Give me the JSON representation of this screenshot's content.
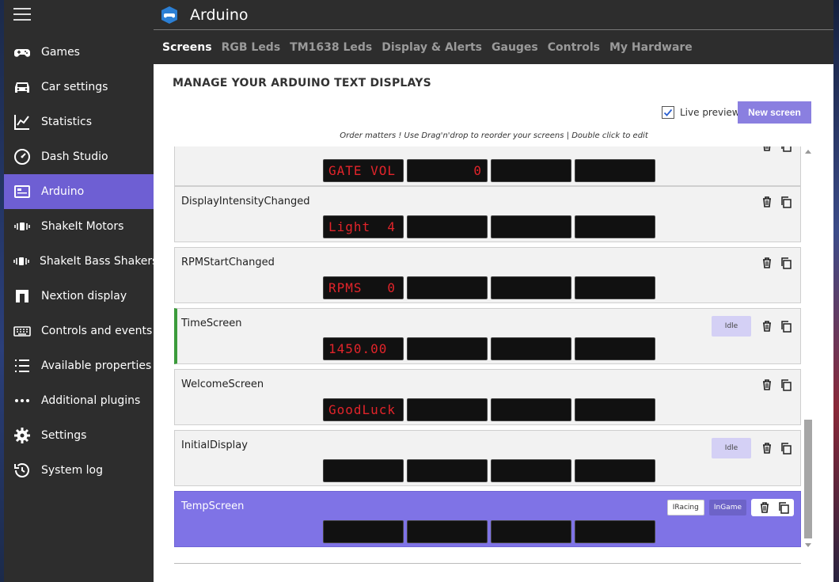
{
  "app": {
    "title": "Arduino"
  },
  "colors": {
    "accent": "#6e5fd3",
    "sidebar": "#2d2d2d",
    "segment_text": "#e2242a"
  },
  "sidebar": {
    "items": [
      {
        "label": "Games",
        "icon": "gamepad-icon"
      },
      {
        "label": "Car settings",
        "icon": "car-icon"
      },
      {
        "label": "Statistics",
        "icon": "chart-icon"
      },
      {
        "label": "Dash Studio",
        "icon": "gauge-icon"
      },
      {
        "label": "Arduino",
        "icon": "arduino-board-icon",
        "active": true
      },
      {
        "label": "ShakeIt Motors",
        "icon": "vibration-icon"
      },
      {
        "label": "ShakeIt Bass Shakers",
        "icon": "vibration-icon"
      },
      {
        "label": "Nextion display",
        "icon": "nextion-icon"
      },
      {
        "label": "Controls and events",
        "icon": "keyboard-icon"
      },
      {
        "label": "Available properties",
        "icon": "list-icon"
      },
      {
        "label": "Additional plugins",
        "icon": "more-dots-icon"
      },
      {
        "label": "Settings",
        "icon": "gear-icon"
      },
      {
        "label": "System log",
        "icon": "history-icon"
      }
    ]
  },
  "tabs": [
    "Screens",
    "RGB Leds",
    "TM1638 Leds",
    "Display & Alerts",
    "Gauges",
    "Controls",
    "My Hardware"
  ],
  "main": {
    "title": "MANAGE YOUR ARDUINO TEXT DISPLAYS",
    "live_preview_label": "Live preview",
    "live_preview_checked": true,
    "new_screen_label": "New screen",
    "hint": "Order matters ! Use Drag'n'drop to reorder your screens | Double click to edit"
  },
  "screens": [
    {
      "name": "",
      "displays": [
        "GATE VOL",
        "       0",
        "",
        ""
      ],
      "tags": []
    },
    {
      "name": "DisplayIntensityChanged",
      "displays": [
        "Light  4",
        "",
        "",
        ""
      ],
      "tags": []
    },
    {
      "name": "RPMStartChanged",
      "displays": [
        "RPMS   0",
        "",
        "",
        ""
      ],
      "tags": []
    },
    {
      "name": "TimeScreen",
      "displays": [
        "1450.00",
        "",
        "",
        ""
      ],
      "tags": [
        "Idle"
      ],
      "active_border": true
    },
    {
      "name": "WelcomeScreen",
      "displays": [
        "GoodLuck",
        "",
        "",
        ""
      ],
      "tags": []
    },
    {
      "name": "InitialDisplay",
      "displays": [
        "",
        "",
        "",
        ""
      ],
      "tags": [
        "Idle"
      ]
    },
    {
      "name": "TempScreen",
      "displays": [
        "",
        "",
        "",
        ""
      ],
      "tags": [
        "IRacing",
        "InGame"
      ],
      "selected": true
    }
  ]
}
